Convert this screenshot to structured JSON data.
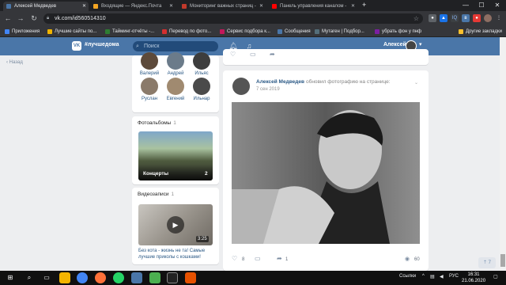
{
  "browser": {
    "tabs": [
      {
        "label": "Алексей Медведев",
        "active": true,
        "favicon_color": "#4a76a8"
      },
      {
        "label": "Входящие — Яндекс.Почта",
        "active": false,
        "favicon_color": "#f5a623"
      },
      {
        "label": "Мониторинг важных страниц -",
        "active": false,
        "favicon_color": "#c0392b"
      },
      {
        "label": "Панель управления каналом -",
        "active": false,
        "favicon_color": "#ff0000"
      }
    ],
    "new_tab": "+",
    "window_controls": {
      "minimize": "—",
      "maximize": "☐",
      "close": "✕"
    },
    "url": "vk.com/id560514310",
    "bookmarks": [
      {
        "label": "Приложения",
        "color": "#4285f4"
      },
      {
        "label": "Лучшие сайты по...",
        "color": "#f0b400"
      },
      {
        "label": "Тайминг-отчёты -...",
        "color": "#2e7d32"
      },
      {
        "label": "Перевод по фото...",
        "color": "#d32f2f"
      },
      {
        "label": "Сервис подбора к...",
        "color": "#c2185b"
      },
      {
        "label": "Сообщения",
        "color": "#4a76a8"
      },
      {
        "label": "Мутаген | Подбор...",
        "color": "#546e7a"
      },
      {
        "label": "убрать фон у пнф",
        "color": "#7b1fa2"
      },
      {
        "label": "Другие закладки",
        "color": "#fbc02d"
      }
    ]
  },
  "vk": {
    "header": {
      "logo": "VK",
      "tagline": "#лучшедома",
      "search_placeholder": "Поиск",
      "user_name": "Алексей"
    },
    "back_link": "Назад",
    "friends": [
      {
        "name": "Валерий"
      },
      {
        "name": "Андрей"
      },
      {
        "name": "Ильяс"
      },
      {
        "name": "Руслан"
      },
      {
        "name": "Евгений"
      },
      {
        "name": "Ильнар"
      }
    ],
    "albums": {
      "title": "Фотоальбомы",
      "count": "1",
      "album_name": "Концерты",
      "album_count": "2"
    },
    "videos": {
      "title": "Видеозаписи",
      "count": "1",
      "duration": "3:25",
      "video_title": "Без кота - жизнь не та! Самые лучшие приколы с кошками!"
    },
    "post": {
      "author": "Алексей Медведев",
      "action": "обновил фотографию на странице:",
      "date": "7 сен 2019",
      "likes": "8",
      "reposts": "1",
      "views": "60"
    },
    "scroll_top_count": "7"
  },
  "taskbar": {
    "language": "РУС",
    "links_label": "Ссылки",
    "time": "16:31",
    "date": "21.06.2020"
  }
}
